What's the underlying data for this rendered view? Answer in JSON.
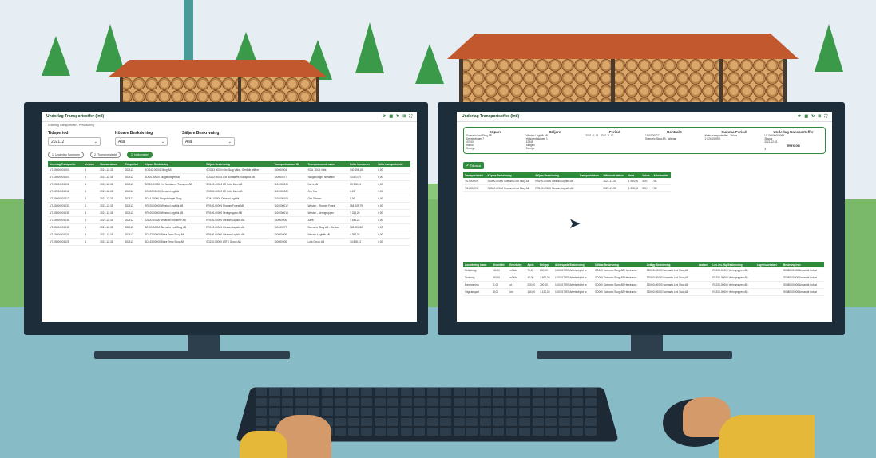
{
  "colors": {
    "accent": "#2f8a3c",
    "roof": "#c2582e",
    "monitor": "#1d2d3a"
  },
  "left_screen": {
    "title": "Underlag Transportsoffer (Intl)",
    "breadcrumb": "Underlag Transportoffer - Periodvaring",
    "filters": [
      {
        "label": "Tidsperiod",
        "value": "202112"
      },
      {
        "label": "Köpare Beskrivning",
        "value": "Alla"
      },
      {
        "label": "Säljare Beskrivning",
        "value": "Alla"
      }
    ],
    "steps": [
      {
        "num": "1",
        "label": "Underlag Summary"
      },
      {
        "num": "2",
        "label": "Transportsledd"
      },
      {
        "num": "3",
        "label": "Indkomsten"
      }
    ],
    "columns": [
      "Underlag Transportör",
      "Version",
      "Skapad datum",
      "Tidsperiod",
      "Köpare Beskrivning",
      "Säljare Beskrivning",
      "Transportsummel ID",
      "Transportsområ namn",
      "Netto leveranser",
      "Netto transportsedel"
    ],
    "rows": [
      [
        "UT-00000001003",
        "1",
        "2021-12-31",
        "202112",
        "SOG42 00001 Skog AB",
        "SOG43 00004 Ost Skog Väla - Område affärer",
        "100000004",
        "SCA - SCA Väla",
        "140 498,18",
        "0,00"
      ],
      [
        "UT-00000001003",
        "1",
        "2021-12-31",
        "202112",
        "SDG4-00000 Skogsbolaget AB",
        "SDG43 00001 Ext Nordaams Transport AB",
        "100000077",
        "Skogsbolaget Nordaam",
        "33 872,07",
        "0,00"
      ],
      [
        "UT-00000001006",
        "1",
        "2021-12-31",
        "202112",
        "ZZ000-00000 Ext Nordaams Transport AB",
        "SG100-00000 LR Kvits Maxi AB",
        "1100000000",
        "Ner's AB",
        "13 308,61",
        "0,00"
      ],
      [
        "UT-00000001011",
        "1",
        "2021-12-31",
        "202112",
        "SG000-00000 Orhaan Logistik",
        "SG000-00000 LR Kvits Maxi AB",
        "1100000080",
        "Orh Kits",
        "0,00",
        "0,00"
      ],
      [
        "UT-00000001012",
        "1",
        "2021-12-31",
        "202112",
        "SD44-00000 Skogsbolaget Skog",
        "SD44-00000 Orhaan Logistik",
        "1100000100",
        "Orh Orhaan",
        "0,00",
        "0,00"
      ],
      [
        "UT-00000001033",
        "1",
        "2021-12-31",
        "202112",
        "RR100-00000 Westan Logistik AB",
        "RR100-00000 Rhamm Forest AB",
        "1100000012",
        "Westan - Rhamm Forest",
        "154 439,79",
        "0,00"
      ],
      [
        "UT-00000001035",
        "1",
        "2021-12-31",
        "202112",
        "RR100-00000 Westan Logistik AB",
        "RR100-00000 Veringruppen AB",
        "1100000015",
        "Westan - Veringruppen",
        "7 313,26",
        "0,00"
      ],
      [
        "UT-00000001035",
        "1",
        "2021-12-31",
        "202112",
        "ZZ800-00000 Ankarakt Industrier AB",
        "RR100-00000 Westan Logistik AB",
        "100000000",
        "Zäne",
        "7 448,22",
        "0,00"
      ],
      [
        "UT-00000001035",
        "1",
        "2021-12-31",
        "202112",
        "SZ100-00000 Scenario Led Skog AB",
        "RR100-00000 Westan Logistik AB",
        "100000077",
        "Scenario Skog AB - Westan",
        "163 024,62",
        "0,00"
      ],
      [
        "UT-00000001020",
        "1",
        "2021-12-31",
        "202112",
        "SD443-00000 Stora Enso Skog AB",
        "RR100-00000 Westan Logistik AB",
        "100000000",
        "Westan Logistik AB",
        "4 393,22",
        "0,00"
      ],
      [
        "UT-00000001025",
        "1",
        "2021-12-31",
        "202112",
        "SD443-00000 Stora Enso Skog AB",
        "SD220-00000 LRTS Group AB",
        "100000000",
        "Lots Group AB",
        "34 808,12",
        "0,00"
      ]
    ]
  },
  "right_screen": {
    "title": "Underlag Transportsoffer (Intl)",
    "summary": {
      "headers": [
        "Köpare",
        "Säljare",
        "Period",
        "Kontrakt",
        "Summa Period",
        "Underlag transportoffer",
        "Version"
      ],
      "kopare": [
        "Scenario Led Skog AB",
        "Dennisvingen 7",
        "47600",
        "Härno",
        "Sverige"
      ],
      "saljare": [
        "Westan Logistik AB",
        "Hälsidenbäckgen 1",
        "12345",
        "Skogen",
        "Sverige"
      ],
      "period": "2021-11-01 - 2021-11-30",
      "kontrakt": [
        "1100000077",
        "Scenario Skog AB - Westan"
      ],
      "summa": [
        "Netto transportsoffer - Volvia",
        "2 820,00 SEK"
      ],
      "underlag": [
        "UT-00000000089",
        "Skapat",
        "2021-12-01"
      ],
      "version": "3"
    },
    "back_label": "Tillbaka",
    "table1": {
      "columns": [
        "Transportsedel",
        "Köpare Beskrivning",
        "Säljare Beskrivning",
        "Transportdatum",
        "Utförande datum",
        "Volla",
        "Valuta",
        "Arbetsorder"
      ],
      "rows": [
        [
          "TS-0000091",
          "SD000-00000 Scenario Led Skog AB",
          "RR100-00000 Westan Logistik AB",
          "",
          "2021-11-30",
          "1 954,00",
          "SEK",
          "SK"
        ],
        [
          "TS-0000092",
          "SD000-00000 Scenario Led Skog AB",
          "RR100-00000 Westan Logistik AB",
          "",
          "2021-11-30",
          "1 328,00",
          "SEK",
          "SK"
        ]
      ]
    },
    "table2": {
      "columns": [
        "Assortering namn",
        "Kvantitet",
        "Enhetsleg",
        "Apris",
        "Belopp",
        "Arbetsplats Beskrivning",
        "Utförar Beskrivning",
        "Avlägg Beskrivning",
        "Lastare",
        "Lev. ins. fkg Beskrivning",
        "Lagerhuset start",
        "Beskrivsgiven"
      ],
      "rows": [
        [
          "Skördning",
          "40,00",
          "m3fub",
          "70,00",
          "800,00",
          "1100017897 Arbetsobjekt nr",
          "SD000 Scenario Skog AB Helstranss",
          "SD000-00000 Scenario Led Skog AB",
          "",
          "R1200-00000 Veringruppen AB",
          "",
          "S0880-00000 Ankarakt Indust"
        ],
        [
          "Skotning",
          "50,00",
          "m3fub",
          "40,00",
          "1 600,00",
          "1100017897 Arbetsobjekt nr",
          "SD000 Scenario Skog AB Helstranss",
          "SD000-00000 Scenario Led Skog AB",
          "",
          "R1200-00000 Veringruppen AB",
          "",
          "S0880-00000 Ankarakt Indust"
        ],
        [
          "Barrkvisning",
          "1,00",
          "st",
          "200,00",
          "200,00",
          "1100017897 Arbetsobjekt nr",
          "SD000 Scenario Skog AB Helstranss",
          "SD000-00000 Scenario Led Skog AB",
          "",
          "R1200-00000 Veringruppen AB",
          "",
          "S0880-00000 Ankarakt Indust"
        ],
        [
          "Vägtransport",
          "8,00",
          "km",
          "140,00",
          "1 120,00",
          "1100017897 Arbetsobjekt nr",
          "SD000 Scenario Skog AB Helstranss",
          "SD000-00000 Scenario Led Skog AB",
          "",
          "R1200-00000 Veringruppen AB",
          "",
          "S0880-00000 Ankarakt Indust"
        ]
      ]
    }
  }
}
